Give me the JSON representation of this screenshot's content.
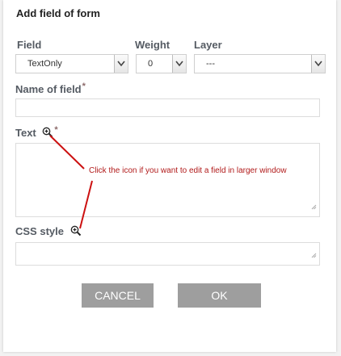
{
  "dialog": {
    "title": "Add field of form"
  },
  "field": {
    "label": "Field",
    "value": "TextOnly"
  },
  "weight": {
    "label": "Weight",
    "value": "0"
  },
  "layer": {
    "label": "Layer",
    "value": "---"
  },
  "name_field": {
    "label": "Name of field",
    "required_mark": "*",
    "value": ""
  },
  "text_field": {
    "label": "Text",
    "required_mark": "*",
    "value": ""
  },
  "css_field": {
    "label": "CSS style",
    "value": ""
  },
  "annotation": {
    "text": "Click the icon if you want to edit a field in larger window",
    "color": "#b11a1a"
  },
  "buttons": {
    "cancel": "CANCEL",
    "ok": "OK"
  },
  "icons": {
    "dropdown": "chevron-down-icon",
    "zoom": "magnifier-plus-icon",
    "resize": "resize-grip-icon"
  }
}
